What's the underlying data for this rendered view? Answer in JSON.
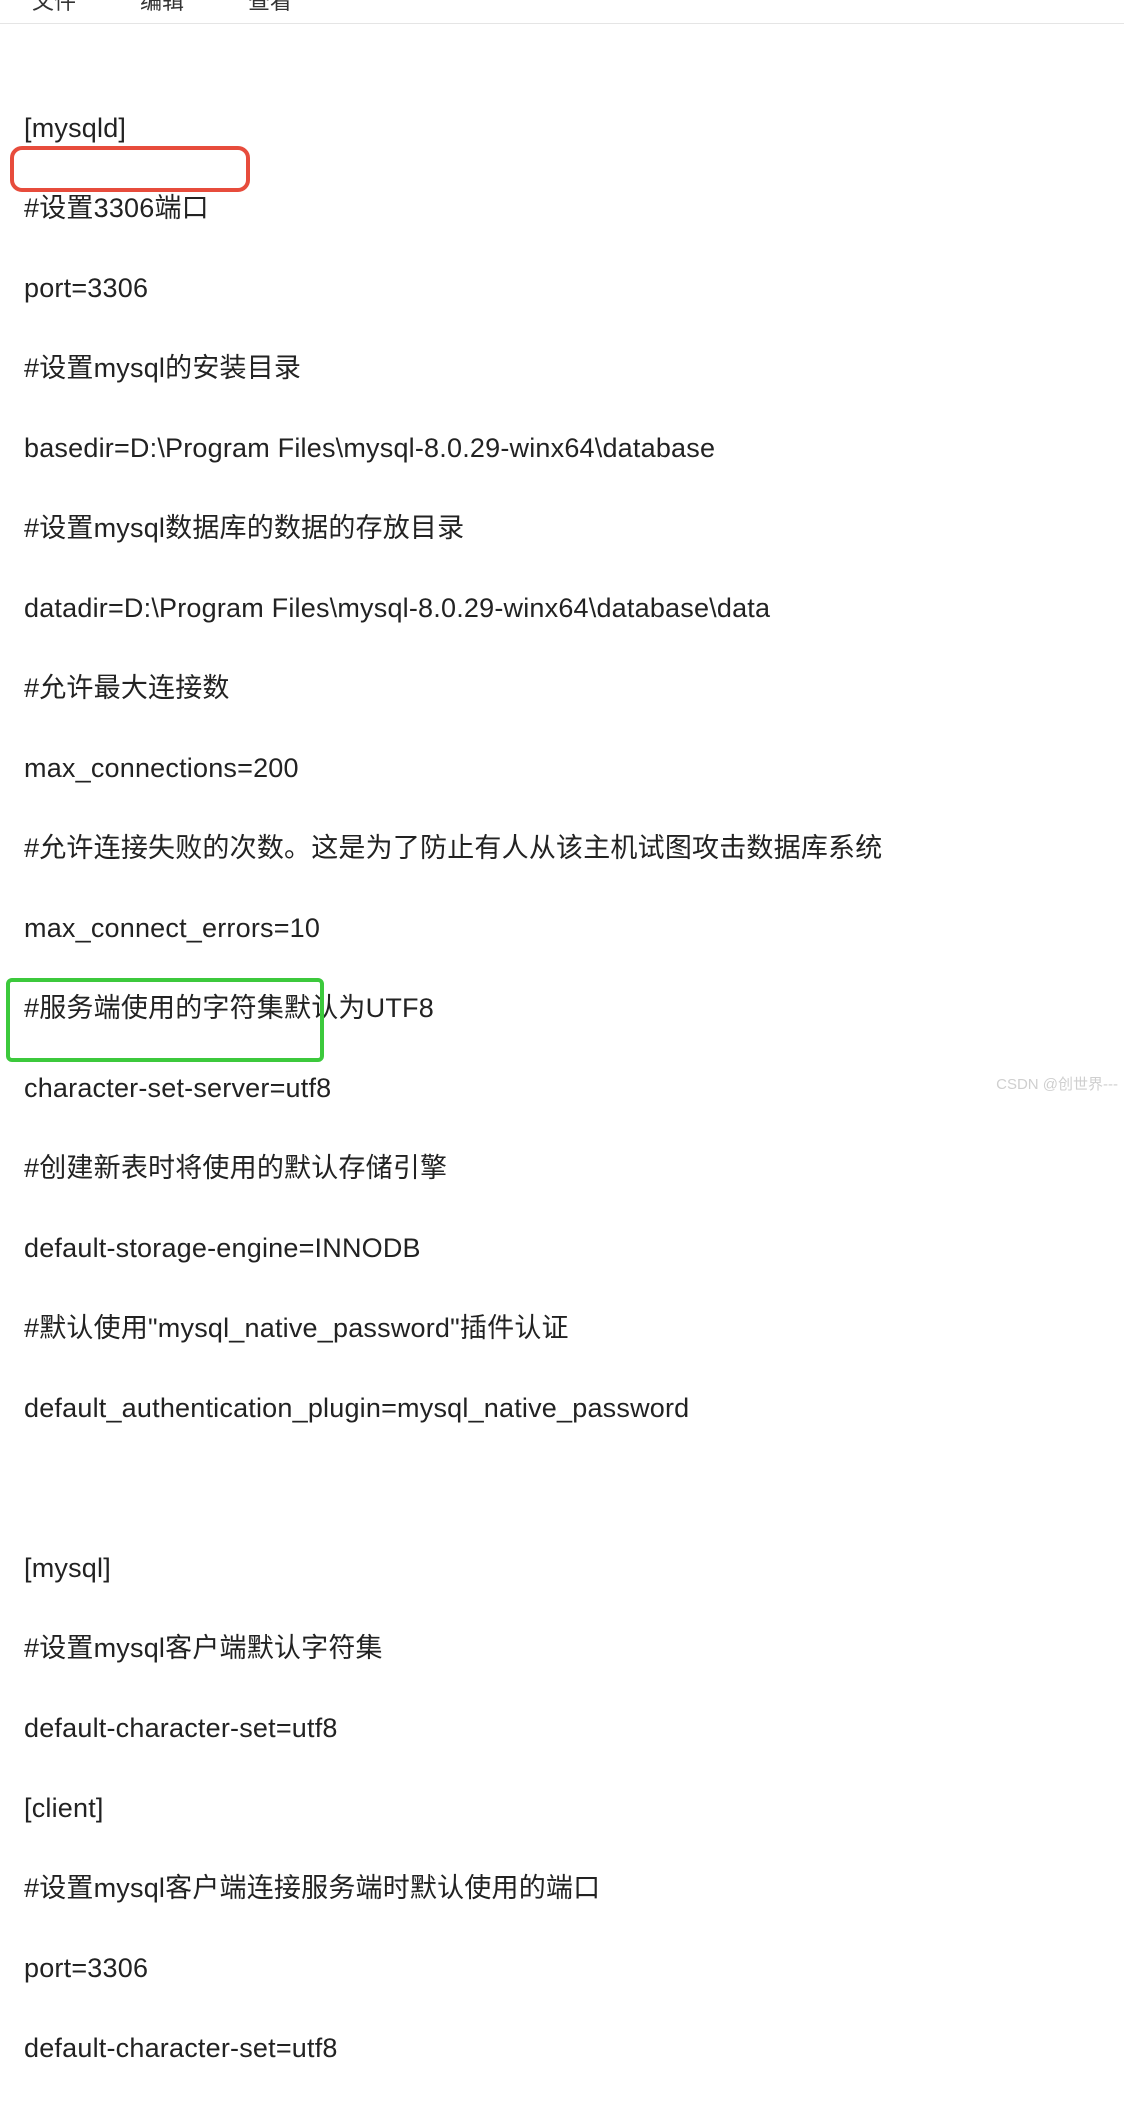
{
  "menubar": {
    "file": "文件",
    "edit": "编辑",
    "view": "查看"
  },
  "config": {
    "section_mysqld": "[mysqld]",
    "comment_port": "#设置3306端口",
    "port_line": "port=3306",
    "comment_basedir": "#设置mysql的安装目录",
    "basedir_line": "basedir=D:\\Program Files\\mysql-8.0.29-winx64\\database",
    "comment_datadir": "#设置mysql数据库的数据的存放目录",
    "datadir_line": "datadir=D:\\Program Files\\mysql-8.0.29-winx64\\database\\data",
    "comment_maxconn": "#允许最大连接数",
    "maxconn_line": "max_connections=200",
    "comment_maxconnerr": "#允许连接失败的次数。这是为了防止有人从该主机试图攻击数据库系统",
    "maxconnerr_line": "max_connect_errors=10",
    "comment_charset": "#服务端使用的字符集默认为UTF8",
    "charset_line": "character-set-server=utf8",
    "comment_engine": "#创建新表时将使用的默认存储引擎",
    "engine_line": "default-storage-engine=INNODB",
    "comment_auth": "#默认使用\"mysql_native_password\"插件认证",
    "auth_line": "default_authentication_plugin=mysql_native_password",
    "blank": " ",
    "section_mysql": "[mysql]",
    "comment_client_charset": "#设置mysql客户端默认字符集",
    "client_charset_line": "default-character-set=utf8",
    "section_client": "[client]",
    "comment_client_port": "#设置mysql客户端连接服务端时默认使用的端口",
    "client_port_line": "port=3306",
    "client_charset_line2": "default-character-set=utf8"
  },
  "watermark": "CSDN @创世界---"
}
